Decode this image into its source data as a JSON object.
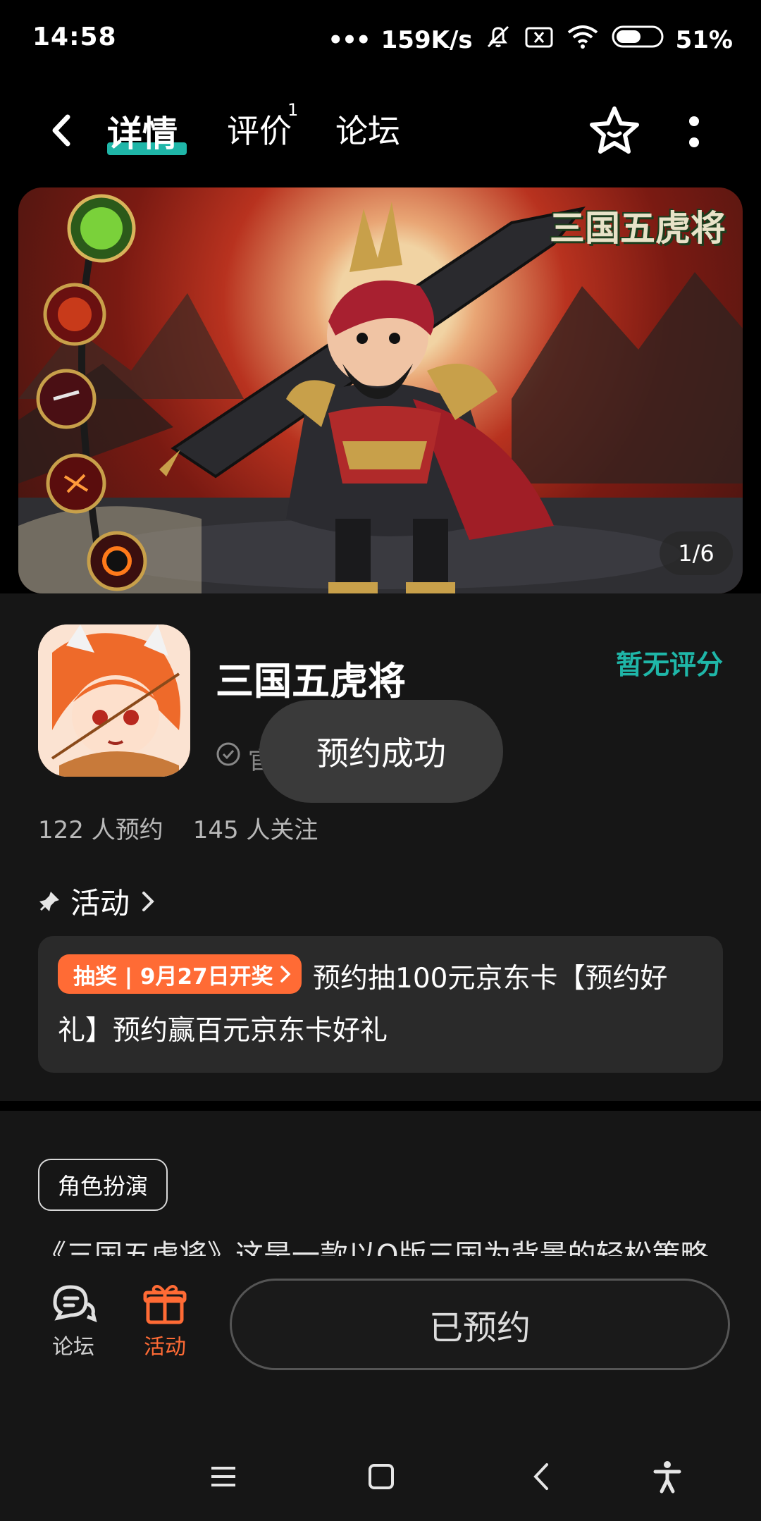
{
  "status_bar": {
    "time": "14:58",
    "dots": "•••",
    "net_speed": "159K/s",
    "battery": "51%",
    "icons": [
      "mute-bell-icon",
      "sim-x-icon",
      "wifi-icon",
      "battery-icon"
    ]
  },
  "header": {
    "tabs": [
      {
        "label": "详情",
        "active": true
      },
      {
        "label": "评价",
        "badge": "1"
      },
      {
        "label": "论坛"
      }
    ],
    "icons": [
      "back-icon",
      "star-icon",
      "more-icon"
    ]
  },
  "banner": {
    "counter": "1/6",
    "logo_text": "三国五虎将"
  },
  "app": {
    "title": "三国五虎将",
    "rating_text": "暂无评分",
    "verified_text": "官",
    "stats": [
      "122 人预约",
      "145 人关注"
    ]
  },
  "toast": {
    "text": "预约成功"
  },
  "activity": {
    "label": "活动",
    "badge": "抽奖 | 9月27日开奖",
    "text": "预约抽100元京东卡【预约好礼】预约赢百元京东卡好礼"
  },
  "tag": "角色扮演",
  "description": "《三国五虎将》这是一款以Q版三国为背景的轻松策略",
  "bottom_nav": {
    "forum_label": "论坛",
    "activity_label": "活动",
    "reserved_label": "已预约"
  },
  "colors": {
    "accent_teal": "#1fb6a8",
    "accent_orange": "#ff6b35",
    "background": "#161616"
  }
}
